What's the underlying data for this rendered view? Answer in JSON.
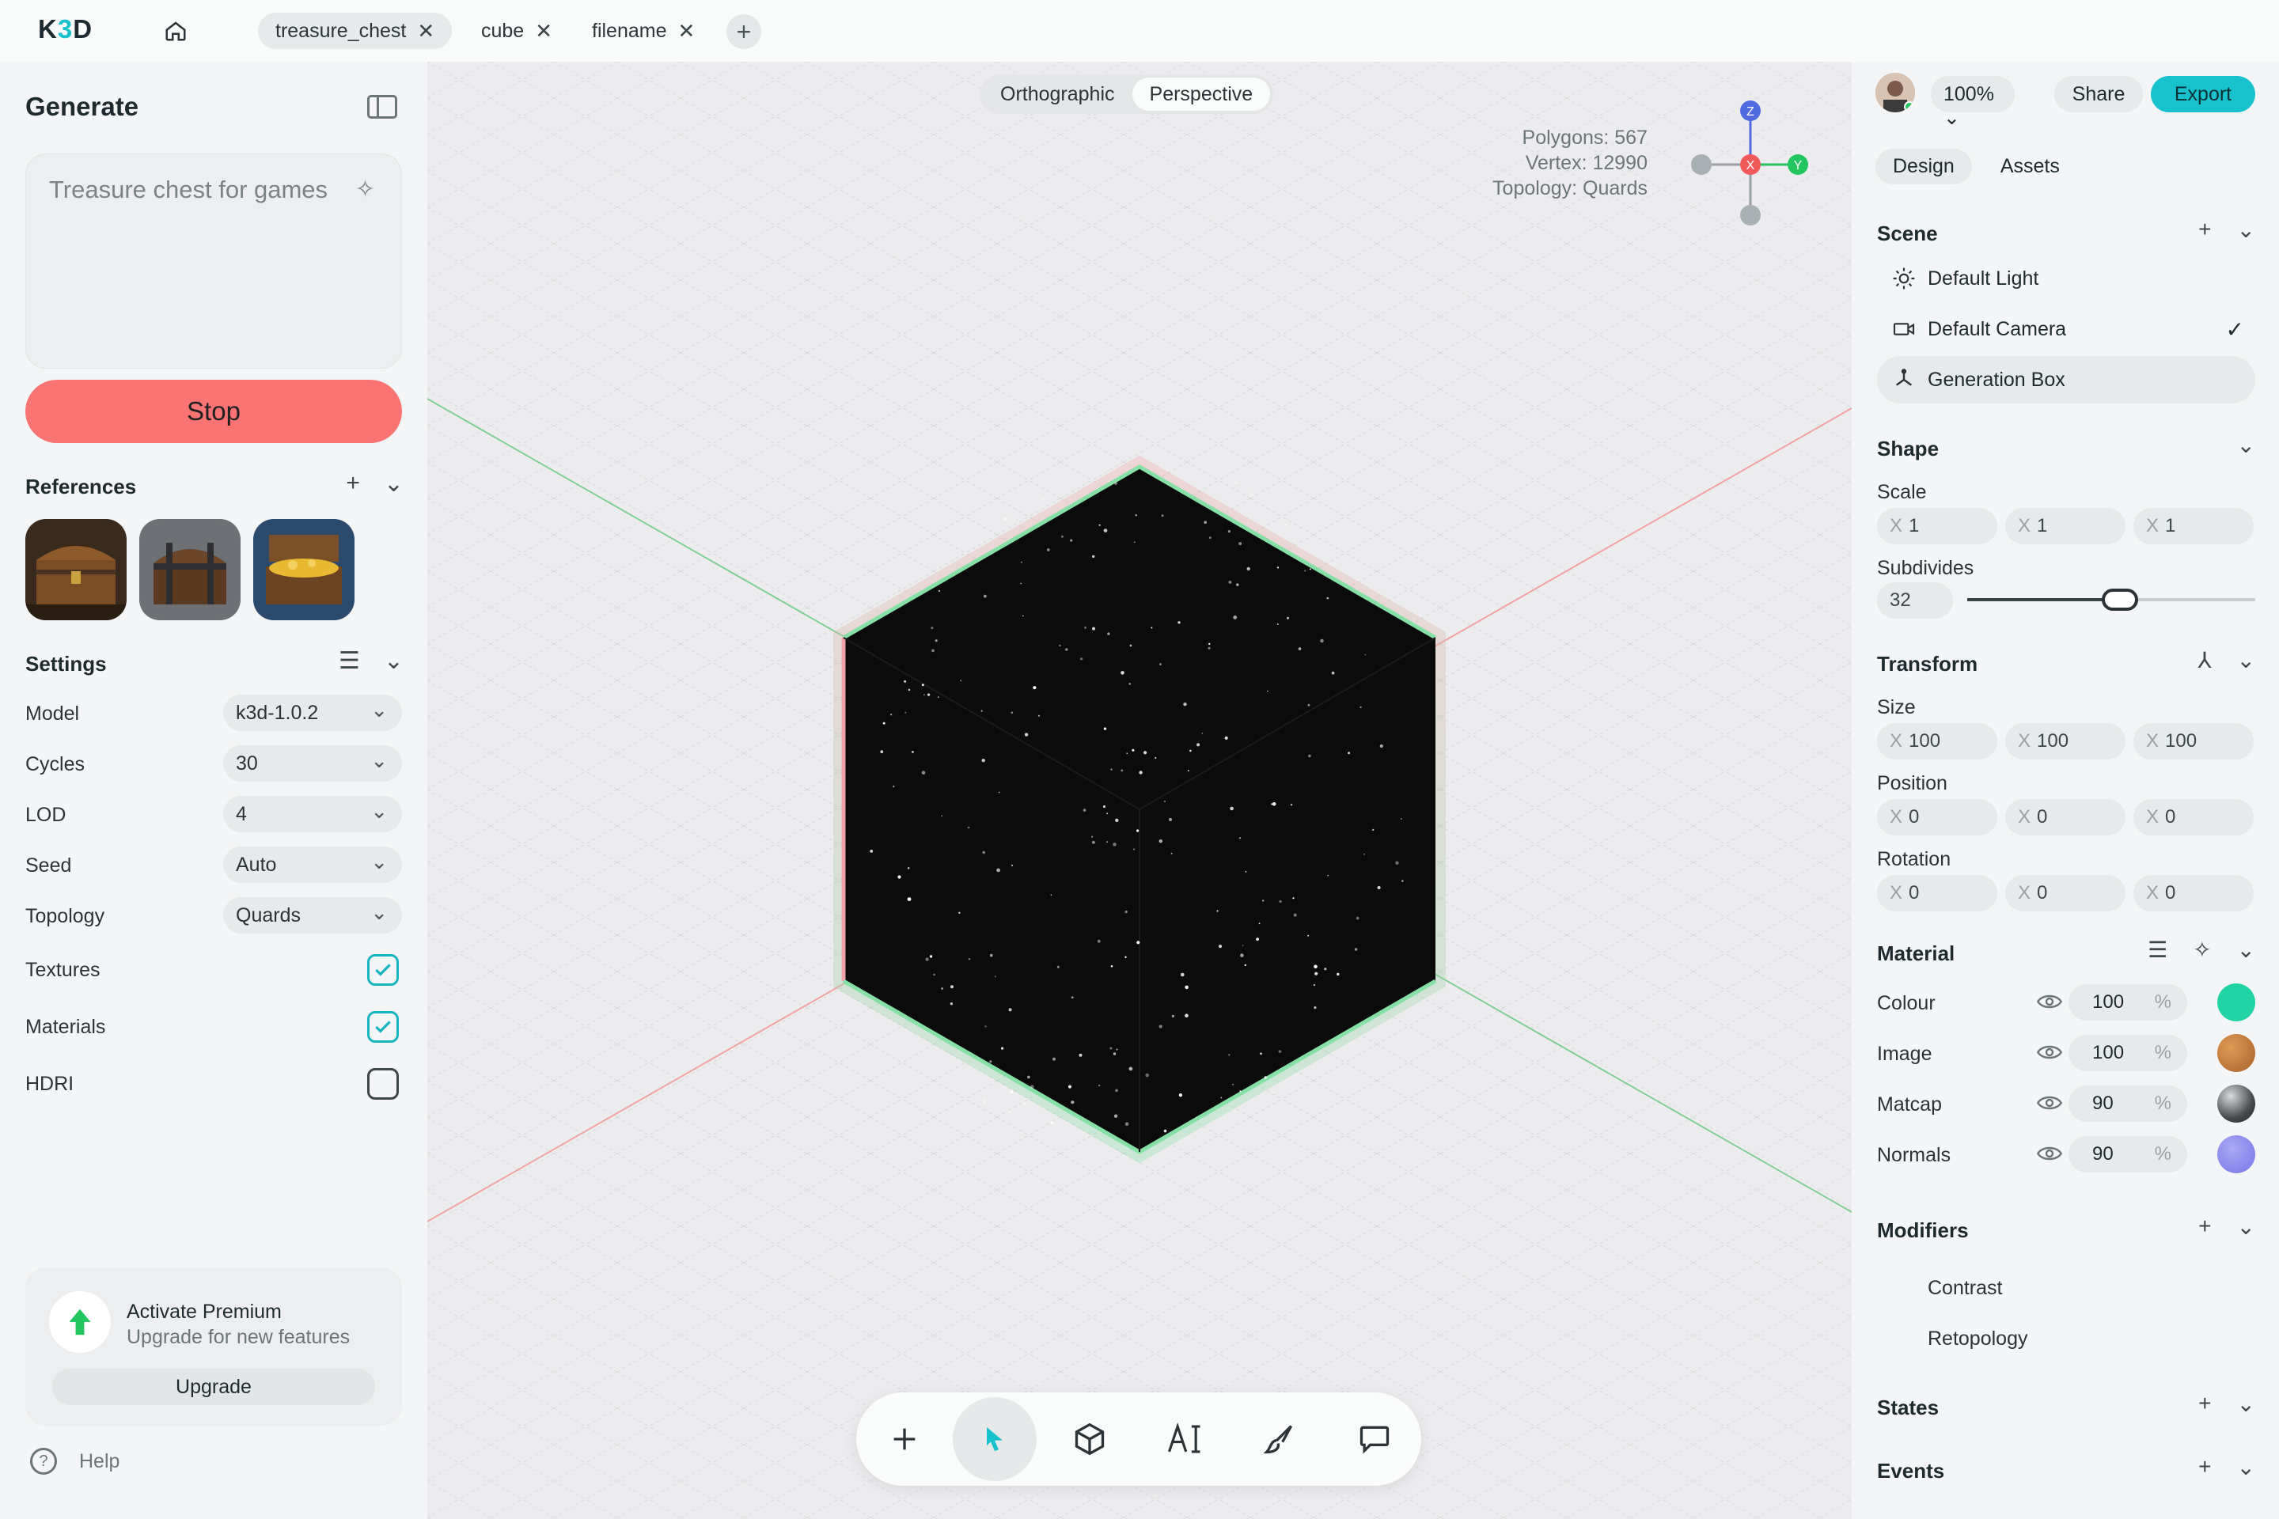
{
  "app": {
    "logo_left": "K",
    "logo_accent": "3",
    "logo_right": "D"
  },
  "tabs": [
    {
      "label": "treasure_chest",
      "active": true
    },
    {
      "label": "cube",
      "active": false
    },
    {
      "label": "filename",
      "active": false
    }
  ],
  "close_glyph": "✕",
  "add_glyph": "+",
  "left": {
    "title": "Generate",
    "prompt_text": "Treasure chest for games",
    "stop_label": "Stop",
    "references_label": "References",
    "settings_label": "Settings",
    "settings": [
      {
        "label": "Model",
        "value": "k3d-1.0.2"
      },
      {
        "label": "Cycles",
        "value": "30"
      },
      {
        "label": "LOD",
        "value": "4"
      },
      {
        "label": "Seed",
        "value": "Auto"
      },
      {
        "label": "Topology",
        "value": "Quards"
      }
    ],
    "toggles": [
      {
        "label": "Textures",
        "checked": true
      },
      {
        "label": "Materials",
        "checked": true
      },
      {
        "label": "HDRI",
        "checked": false
      }
    ],
    "premium": {
      "title": "Activate Premium",
      "subtitle": "Upgrade for new features",
      "button": "Upgrade"
    },
    "help_label": "Help",
    "help_glyph": "?"
  },
  "canvas": {
    "view_options": [
      "Orthographic",
      "Perspective"
    ],
    "selected_view": "Perspective",
    "stats": {
      "polygons": "Polygons: 567",
      "vertex": "Vertex: 12990",
      "topology": "Topology: Quards"
    },
    "axes": {
      "z": "Z",
      "x": "X",
      "y": "Y"
    },
    "tools": [
      "add",
      "select",
      "cube",
      "ai-text",
      "brush",
      "comment"
    ],
    "selected_tool": "select",
    "colors": {
      "axis_x": "#f25a5a",
      "axis_y": "#22c55e",
      "axis_z": "#4f6bdf"
    }
  },
  "right": {
    "zoom": "100%",
    "share": "Share",
    "export": "Export",
    "tabs": [
      "Design",
      "Assets"
    ],
    "scene_label": "Scene",
    "scene_items": [
      {
        "label": "Default Light",
        "icon": "sun-icon"
      },
      {
        "label": "Default Camera",
        "icon": "camera-icon",
        "checked": true
      },
      {
        "label": "Generation Box",
        "icon": "axes-icon",
        "selected": true
      }
    ],
    "check_glyph": "✓",
    "shape_label": "Shape",
    "scale_label": "Scale",
    "scale": [
      "1",
      "1",
      "1"
    ],
    "subdivides_label": "Subdivides",
    "subdivides": "32",
    "transform_label": "Transform",
    "size_label": "Size",
    "size": [
      "100",
      "100",
      "100"
    ],
    "position_label": "Position",
    "position": [
      "0",
      "0",
      "0"
    ],
    "rotation_label": "Rotation",
    "rotation": [
      "0",
      "0",
      "0"
    ],
    "axis_prefix": "X",
    "material_label": "Material",
    "percent_sign": "%",
    "materials": [
      {
        "label": "Colour",
        "value": "100",
        "swatch": "#22d3a5"
      },
      {
        "label": "Image",
        "value": "100",
        "swatch": "#c97b3a"
      },
      {
        "label": "Matcap",
        "value": "90",
        "swatch": "#5b5f63"
      },
      {
        "label": "Normals",
        "value": "90",
        "swatch": "#8c8cf0"
      }
    ],
    "modifiers_label": "Modifiers",
    "modifiers": [
      "Contrast",
      "Retopology"
    ],
    "states_label": "States",
    "events_label": "Events"
  },
  "accent_color": "#17c2cc",
  "stop_color": "#fb7474"
}
